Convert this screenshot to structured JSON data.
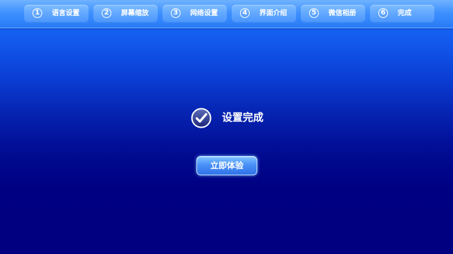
{
  "steps": [
    {
      "number": "1",
      "label": "语言设置"
    },
    {
      "number": "2",
      "label": "屏幕缩放"
    },
    {
      "number": "3",
      "label": "网络设置"
    },
    {
      "number": "4",
      "label": "界面介绍"
    },
    {
      "number": "5",
      "label": "微信相册"
    },
    {
      "number": "6",
      "label": "完成"
    }
  ],
  "completion": {
    "icon": "checkmark-circle-icon",
    "title": "设置完成",
    "button_label": "立即体验"
  },
  "colors": {
    "top_gradient": "#1f7cff",
    "bottom_background": "#000080",
    "step_bar": "#3f91ff",
    "button": "#4a91f8",
    "text": "#ffffff"
  }
}
